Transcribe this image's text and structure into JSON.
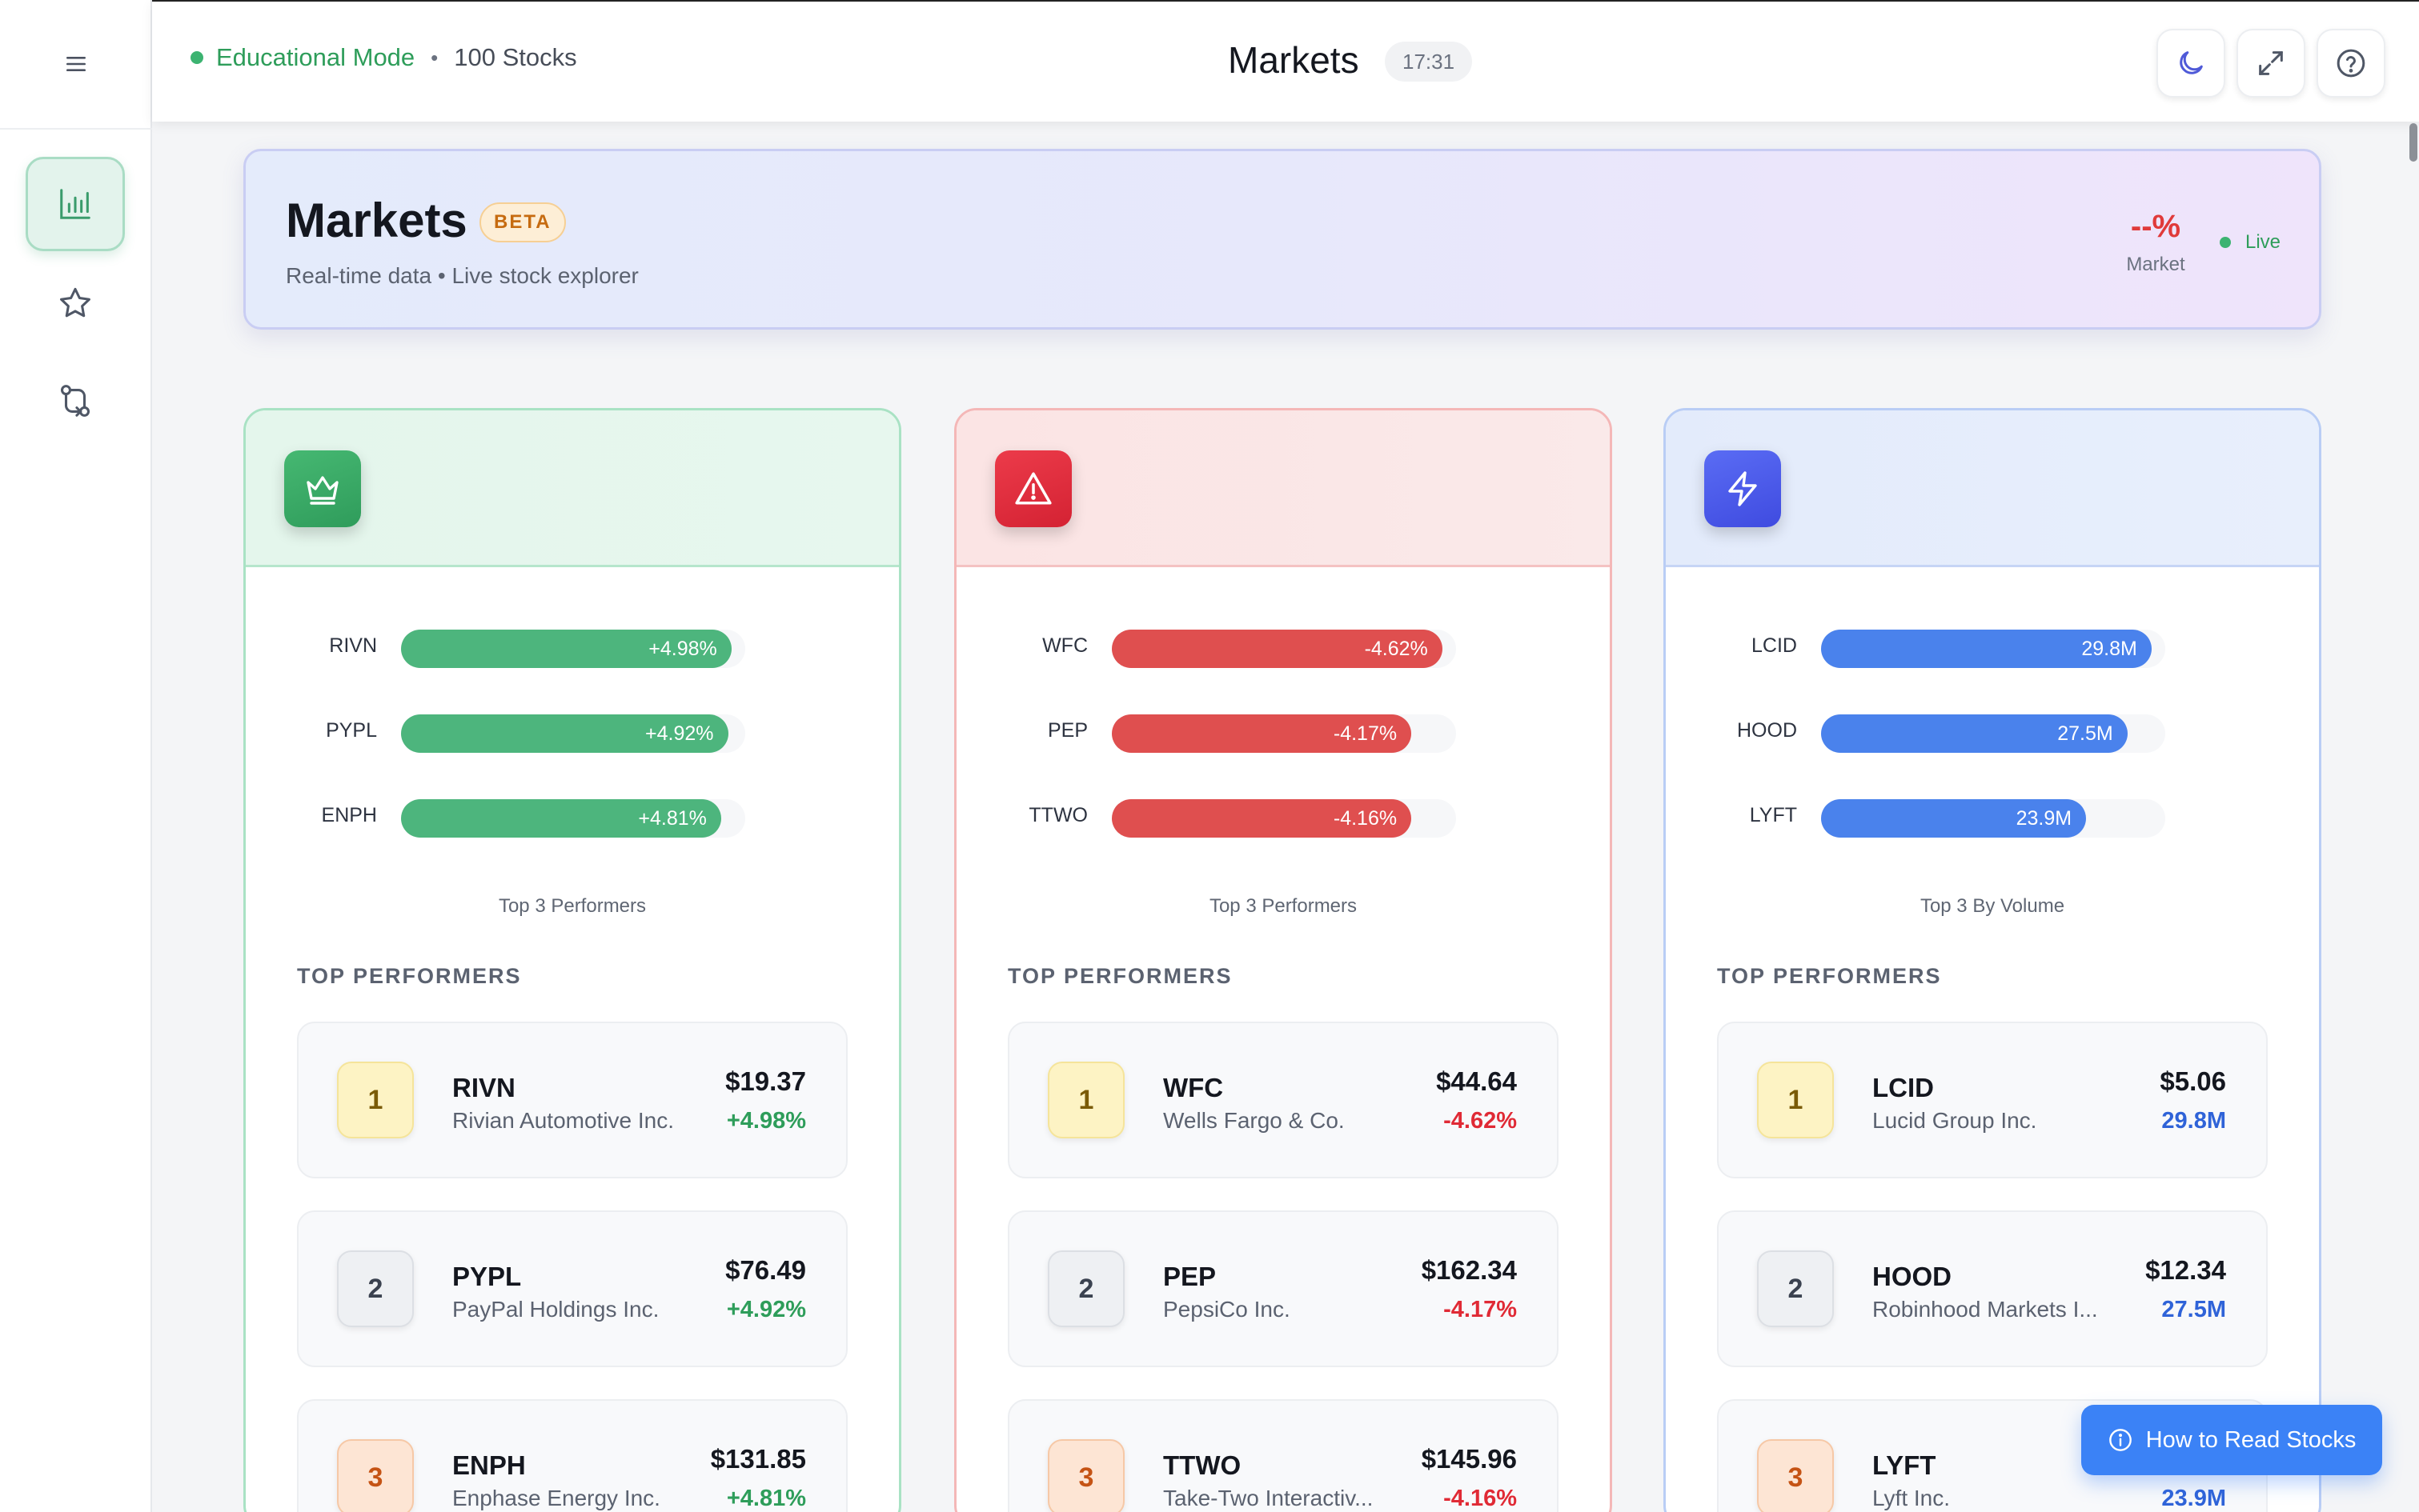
{
  "topbar": {
    "mode_label": "Educational Mode",
    "separator": "•",
    "stock_count": "100 Stocks",
    "title": "Markets",
    "time": "17:31"
  },
  "hero": {
    "title": "Markets",
    "badge": "BETA",
    "subtitle": "Real-time data • Live stock explorer",
    "market_change": "--%",
    "market_label": "Market",
    "live_label": "Live"
  },
  "cards": [
    {
      "theme": "green",
      "icon": "crown-icon",
      "bars": [
        {
          "symbol": "RIVN",
          "label": "+4.98%",
          "fraction": 0.96
        },
        {
          "symbol": "PYPL",
          "label": "+4.92%",
          "fraction": 0.95
        },
        {
          "symbol": "ENPH",
          "label": "+4.81%",
          "fraction": 0.93
        }
      ],
      "caption": "Top 3 Performers",
      "section_title": "TOP PERFORMERS",
      "stocks": [
        {
          "rank": "1",
          "symbol": "RIVN",
          "name": "Rivian Automotive Inc.",
          "price": "$19.37",
          "change": "+4.98%"
        },
        {
          "rank": "2",
          "symbol": "PYPL",
          "name": "PayPal Holdings Inc.",
          "price": "$76.49",
          "change": "+4.92%"
        },
        {
          "rank": "3",
          "symbol": "ENPH",
          "name": "Enphase Energy Inc.",
          "price": "$131.85",
          "change": "+4.81%"
        }
      ]
    },
    {
      "theme": "red",
      "icon": "warning-icon",
      "bars": [
        {
          "symbol": "WFC",
          "label": "-4.62%",
          "fraction": 0.96
        },
        {
          "symbol": "PEP",
          "label": "-4.17%",
          "fraction": 0.87
        },
        {
          "symbol": "TTWO",
          "label": "-4.16%",
          "fraction": 0.87
        }
      ],
      "caption": "Top 3 Performers",
      "section_title": "TOP PERFORMERS",
      "stocks": [
        {
          "rank": "1",
          "symbol": "WFC",
          "name": "Wells Fargo & Co.",
          "price": "$44.64",
          "change": "-4.62%"
        },
        {
          "rank": "2",
          "symbol": "PEP",
          "name": "PepsiCo Inc.",
          "price": "$162.34",
          "change": "-4.17%"
        },
        {
          "rank": "3",
          "symbol": "TTWO",
          "name": "Take-Two Interactiv...",
          "price": "$145.96",
          "change": "-4.16%"
        }
      ]
    },
    {
      "theme": "blue",
      "icon": "lightning-icon",
      "bars": [
        {
          "symbol": "LCID",
          "label": "29.8M",
          "fraction": 0.96
        },
        {
          "symbol": "HOOD",
          "label": "27.5M",
          "fraction": 0.89
        },
        {
          "symbol": "LYFT",
          "label": "23.9M",
          "fraction": 0.77
        }
      ],
      "caption": "Top 3 By Volume",
      "section_title": "TOP PERFORMERS",
      "stocks": [
        {
          "rank": "1",
          "symbol": "LCID",
          "name": "Lucid Group Inc.",
          "price": "$5.06",
          "change": "29.8M"
        },
        {
          "rank": "2",
          "symbol": "HOOD",
          "name": "Robinhood Markets I...",
          "price": "$12.34",
          "change": "27.5M"
        },
        {
          "rank": "3",
          "symbol": "LYFT",
          "name": "Lyft Inc.",
          "price": "",
          "change": "23.9M"
        }
      ]
    }
  ],
  "help_button": {
    "label": "How to Read Stocks"
  },
  "colors": {
    "accent_green": "#2e9d5a",
    "accent_red": "#e02a35",
    "accent_blue": "#3b82f6"
  }
}
